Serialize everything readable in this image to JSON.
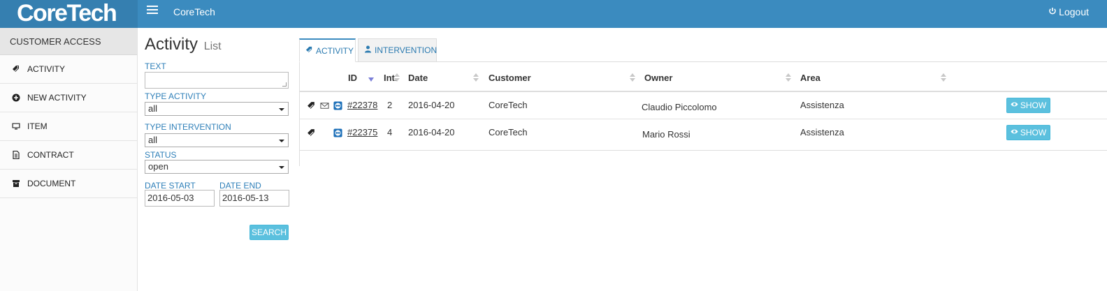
{
  "app": {
    "logo": "CoreTech",
    "title": "CoreTech",
    "logout_label": "Logout"
  },
  "sidebar": {
    "header": "CUSTOMER ACCESS",
    "items": [
      {
        "label": "ACTIVITY",
        "icon": "tag-icon"
      },
      {
        "label": "NEW ACTIVITY",
        "icon": "plus-circle-icon"
      },
      {
        "label": "ITEM",
        "icon": "monitor-icon"
      },
      {
        "label": "CONTRACT",
        "icon": "file-icon"
      },
      {
        "label": "DOCUMENT",
        "icon": "archive-icon"
      }
    ]
  },
  "filters": {
    "title": "Activity",
    "subtitle": "List",
    "text_label": "TEXT",
    "text_value": "",
    "type_activity_label": "TYPE ACTIVITY",
    "type_activity_value": "all",
    "type_intervention_label": "TYPE INTERVENTION",
    "type_intervention_value": "all",
    "status_label": "STATUS",
    "status_value": "open",
    "date_start_label": "DATE START",
    "date_start_value": "2016-05-03",
    "date_end_label": "DATE END",
    "date_end_value": "2016-05-13",
    "search_label": "SEARCH"
  },
  "tabs": [
    {
      "label": "ACTIVITY",
      "icon": "tag-icon",
      "active": true
    },
    {
      "label": "INTERVENTION",
      "icon": "user-icon",
      "active": false
    }
  ],
  "table": {
    "columns": [
      "ID",
      "Int.",
      "Date",
      "Customer",
      "Owner",
      "Area"
    ],
    "sort_column": "ID",
    "sort_direction": "desc",
    "action_label": "SHOW",
    "rows": [
      {
        "id": "#22378",
        "int": "2",
        "date": "2016-04-20",
        "customer": "CoreTech",
        "owner": "Claudio Piccolomo",
        "area": "Assistenza",
        "has_mail": true
      },
      {
        "id": "#22375",
        "int": "4",
        "date": "2016-04-20",
        "customer": "CoreTech",
        "owner": "Mario Rossi",
        "area": "Assistenza",
        "has_mail": false
      }
    ]
  },
  "colors": {
    "topbar": "#3b8bbf",
    "accent": "#2e7fb8",
    "button": "#5bc0de"
  }
}
